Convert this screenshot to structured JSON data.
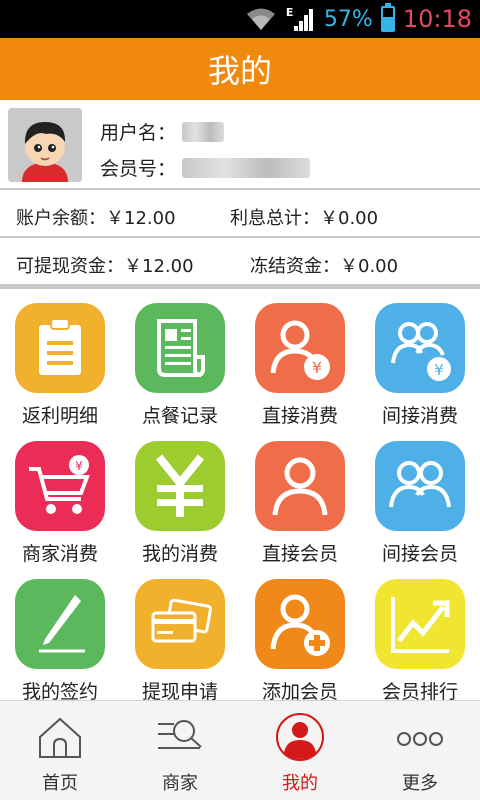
{
  "status_bar": {
    "network_type": "E",
    "battery_percent": "57%",
    "battery_level": 0.57,
    "time": "10:18"
  },
  "header": {
    "title": "我的"
  },
  "profile": {
    "username_label": "用户名：",
    "member_no_label": "会员号："
  },
  "funds": {
    "balance_label": "账户余额：￥12.00",
    "interest_label": "利息总计：￥0.00",
    "withdrawable_label": "可提现资金：￥12.00",
    "frozen_label": "冻结资金：￥0.00"
  },
  "grid": {
    "items": [
      {
        "label": "返利明细",
        "icon": "clipboard-icon",
        "color": "#f2b12c"
      },
      {
        "label": "点餐记录",
        "icon": "receipt-icon",
        "color": "#5cb85c"
      },
      {
        "label": "直接消费",
        "icon": "person-yen-icon",
        "color": "#ef6e49"
      },
      {
        "label": "间接消费",
        "icon": "group-yen-icon",
        "color": "#4fb0e8"
      },
      {
        "label": "商家消费",
        "icon": "cart-yen-icon",
        "color": "#ea2c57"
      },
      {
        "label": "我的消费",
        "icon": "yen-icon",
        "color": "#9ccc2d"
      },
      {
        "label": "直接会员",
        "icon": "person-icon",
        "color": "#ef6e49"
      },
      {
        "label": "间接会员",
        "icon": "group-icon",
        "color": "#4fb0e8"
      },
      {
        "label": "我的签约",
        "icon": "pen-icon",
        "color": "#5cb85c"
      },
      {
        "label": "提现申请",
        "icon": "cards-icon",
        "color": "#f2b12c"
      },
      {
        "label": "添加会员",
        "icon": "person-add-icon",
        "color": "#f0891a"
      },
      {
        "label": "会员排行",
        "icon": "trend-chart-icon",
        "color": "#f0e632"
      }
    ]
  },
  "bottom_nav": {
    "items": [
      {
        "label": "首页",
        "icon": "home-icon"
      },
      {
        "label": "商家",
        "icon": "search-list-icon"
      },
      {
        "label": "我的",
        "icon": "profile-icon",
        "active": true
      },
      {
        "label": "更多",
        "icon": "more-dots-icon"
      }
    ],
    "active_color": "#d3191a"
  },
  "colors": {
    "header": "#f0890c",
    "statusbar_text": "#35b5e5",
    "time_text": "#e54866"
  }
}
